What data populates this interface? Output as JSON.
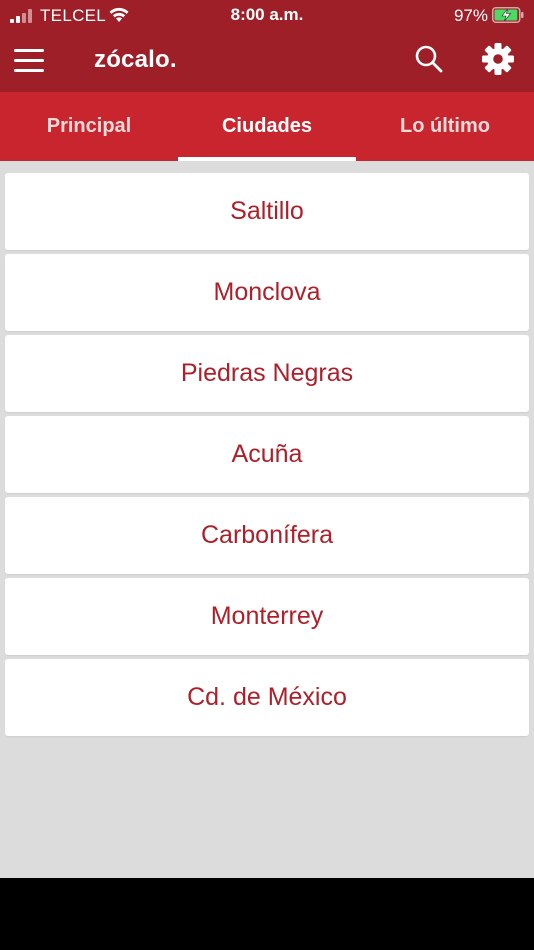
{
  "status_bar": {
    "carrier": "TELCEL",
    "time": "8:00 a.m.",
    "battery_percent": "97%",
    "battery_level": 0.97
  },
  "app_bar": {
    "logo": "zócalo.",
    "menu_icon": "hamburger-menu-icon",
    "search_icon": "search-icon",
    "settings_icon": "gear-icon"
  },
  "tabs": [
    {
      "label": "Principal",
      "active": false
    },
    {
      "label": "Ciudades",
      "active": true
    },
    {
      "label": "Lo último",
      "active": false
    }
  ],
  "cities": [
    {
      "label": "Saltillo"
    },
    {
      "label": "Monclova"
    },
    {
      "label": "Piedras Negras"
    },
    {
      "label": "Acuña"
    },
    {
      "label": "Carbonífera"
    },
    {
      "label": "Monterrey"
    },
    {
      "label": "Cd. de México"
    }
  ],
  "colors": {
    "app_bar": "#9e1f27",
    "tab_bar": "#c8252e",
    "city_text": "#b01f29",
    "background": "#dcdcdc",
    "battery_fill": "#4cd964"
  }
}
